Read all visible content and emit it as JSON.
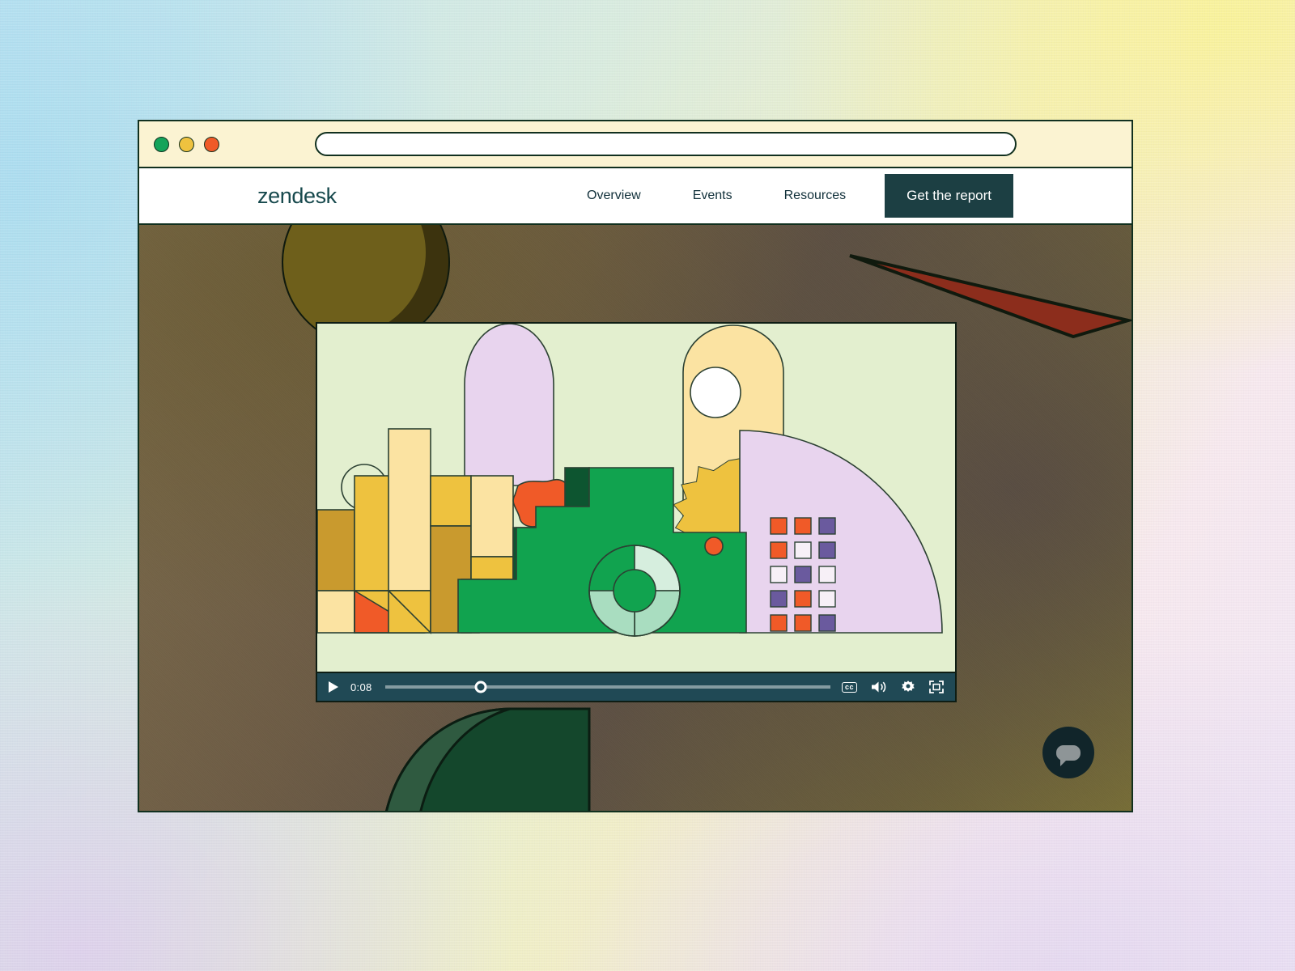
{
  "browser": {
    "traffic_lights": [
      {
        "name": "close-dot",
        "color": "#14a35a"
      },
      {
        "name": "minimize-dot",
        "color": "#eec23f"
      },
      {
        "name": "maximize-dot",
        "color": "#f05a28"
      }
    ],
    "url_value": "",
    "url_placeholder": ""
  },
  "nav": {
    "logo": "zendesk",
    "links": [
      {
        "label": "Overview"
      },
      {
        "label": "Events"
      },
      {
        "label": "Resources"
      }
    ],
    "cta_label": "Get the report",
    "cta_color": "#1c3f43"
  },
  "player": {
    "time_label": "0:08",
    "progress_percent": 21.5,
    "play_icon": "play-icon",
    "controls": [
      {
        "name": "captions-button",
        "label": "cc"
      },
      {
        "name": "volume-button",
        "label": "volume-icon"
      },
      {
        "name": "settings-button",
        "label": "gear-icon"
      },
      {
        "name": "fullscreen-button",
        "label": "fullscreen-icon"
      }
    ],
    "bar_color": "#204955",
    "canvas_color": "#e3efcf"
  },
  "illustration": {
    "title": "abstract-geometric-animation",
    "palette": {
      "background": "#e3efcf",
      "outline": "#2c4133",
      "green": "#11a34f",
      "dark_green": "#0d5530",
      "mint": "#a9ddc0",
      "pale_mint": "#d6eede",
      "yellow": "#eec23f",
      "pale_yellow": "#fbe3a2",
      "light_yellow": "#f9e6ae",
      "ochre": "#c99a2e",
      "orange": "#f05a28",
      "lilac": "#e8d4ee",
      "purple": "#6a5a9e",
      "white": "#ffffff",
      "offwhite": "#f7f0f7"
    },
    "square_grid": {
      "rows": 5,
      "cols": 3,
      "colors": [
        [
          "orange",
          "orange",
          "purple"
        ],
        [
          "orange",
          "offwhite",
          "purple"
        ],
        [
          "offwhite",
          "purple",
          "offwhite"
        ],
        [
          "purple",
          "orange",
          "offwhite"
        ],
        [
          "orange",
          "orange",
          "purple"
        ]
      ]
    }
  },
  "scene": {
    "bg_circle": {
      "name": "olive-circle",
      "color": "#6e5f1b"
    },
    "bg_triangle": {
      "name": "maroon-triangle",
      "color": "#8c2d1c"
    },
    "bg_dome": {
      "name": "green-dome",
      "color": "#14472c"
    },
    "chat_button": {
      "name": "chat-widget-button",
      "color": "#11252a"
    }
  }
}
